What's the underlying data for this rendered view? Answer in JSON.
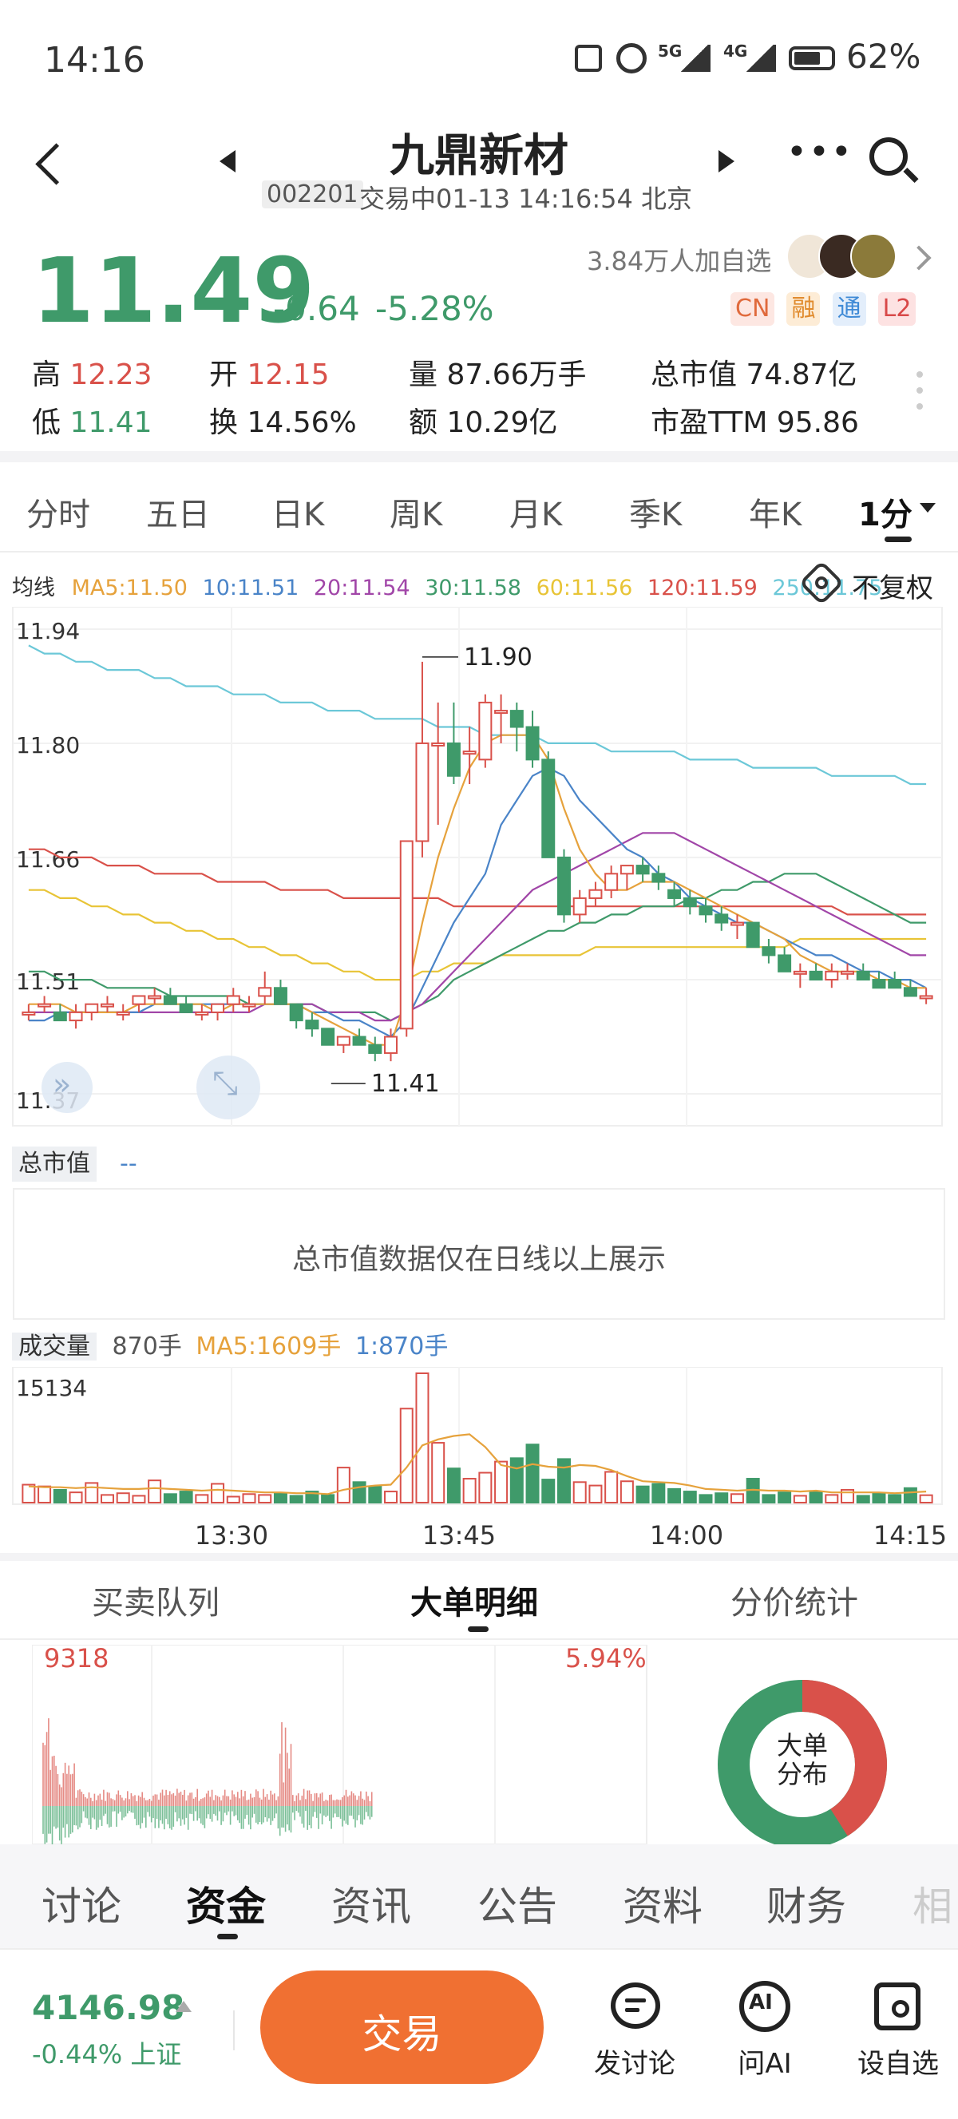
{
  "status_bar": {
    "time": "14:16",
    "battery": "62%",
    "net1": "5G",
    "net2": "4G"
  },
  "header": {
    "title": "九鼎新材",
    "code": "002201",
    "status": "交易中01-13 14:16:54 北京"
  },
  "quote": {
    "price": "11.49",
    "change": "-0.64",
    "change_pct": "-5.28%",
    "watchers": "3.84万人加自选",
    "badges": [
      "CN",
      "融",
      "通",
      "L2"
    ],
    "stats": [
      {
        "label": "高",
        "value": "12.23",
        "tone": "red"
      },
      {
        "label": "开",
        "value": "12.15",
        "tone": "red"
      },
      {
        "label": "量",
        "value": "87.66万手",
        "tone": "dark"
      },
      {
        "label": "总市值",
        "value": "74.87亿",
        "tone": "dark"
      },
      {
        "label": "低",
        "value": "11.41",
        "tone": "green"
      },
      {
        "label": "换",
        "value": "14.56%",
        "tone": "dark"
      },
      {
        "label": "额",
        "value": "10.29亿",
        "tone": "dark"
      },
      {
        "label": "市盈TTM",
        "value": "95.86",
        "tone": "dark"
      }
    ]
  },
  "period_tabs": [
    "分时",
    "五日",
    "日K",
    "周K",
    "月K",
    "季K",
    "年K",
    "1分"
  ],
  "ma_legend": {
    "label": "均线",
    "items": [
      {
        "text": "MA5:11.50",
        "color": "#e6a23c"
      },
      {
        "text": "10:11.51",
        "color": "#4a84c8"
      },
      {
        "text": "20:11.54",
        "color": "#a146a8"
      },
      {
        "text": "30:11.58",
        "color": "#3f9a6a"
      },
      {
        "text": "60:11.56",
        "color": "#e8c436"
      },
      {
        "text": "120:11.59",
        "color": "#d9514a"
      },
      {
        "text": "250:11.75",
        "color": "#6cc8d8"
      }
    ],
    "adjust": "不复权"
  },
  "chart_data": {
    "type": "candlestick",
    "y_ticks": [
      "11.94",
      "11.80",
      "11.66",
      "11.51",
      "11.37"
    ],
    "ylim": [
      11.37,
      11.94
    ],
    "high_annotation": "11.90",
    "low_annotation": "11.41",
    "candles": [
      [
        11.47,
        11.48,
        11.46,
        11.47
      ],
      [
        11.48,
        11.49,
        11.47,
        11.48
      ],
      [
        11.47,
        11.48,
        11.46,
        11.46
      ],
      [
        11.46,
        11.48,
        11.45,
        11.47
      ],
      [
        11.47,
        11.48,
        11.46,
        11.48
      ],
      [
        11.48,
        11.49,
        11.47,
        11.48
      ],
      [
        11.47,
        11.48,
        11.46,
        11.47
      ],
      [
        11.48,
        11.49,
        11.47,
        11.49
      ],
      [
        11.49,
        11.5,
        11.48,
        11.49
      ],
      [
        11.49,
        11.5,
        11.48,
        11.48
      ],
      [
        11.48,
        11.49,
        11.47,
        11.47
      ],
      [
        11.47,
        11.48,
        11.46,
        11.47
      ],
      [
        11.47,
        11.48,
        11.46,
        11.48
      ],
      [
        11.48,
        11.5,
        11.47,
        11.49
      ],
      [
        11.48,
        11.49,
        11.47,
        11.48
      ],
      [
        11.49,
        11.52,
        11.48,
        11.5
      ],
      [
        11.5,
        11.51,
        11.48,
        11.48
      ],
      [
        11.48,
        11.48,
        11.45,
        11.46
      ],
      [
        11.46,
        11.47,
        11.44,
        11.45
      ],
      [
        11.45,
        11.45,
        11.43,
        11.43
      ],
      [
        11.43,
        11.44,
        11.42,
        11.44
      ],
      [
        11.44,
        11.45,
        11.43,
        11.43
      ],
      [
        11.43,
        11.44,
        11.41,
        11.42
      ],
      [
        11.42,
        11.45,
        11.41,
        11.44
      ],
      [
        11.45,
        11.68,
        11.44,
        11.68
      ],
      [
        11.68,
        11.9,
        11.66,
        11.8
      ],
      [
        11.8,
        11.85,
        11.7,
        11.8
      ],
      [
        11.8,
        11.85,
        11.75,
        11.76
      ],
      [
        11.79,
        11.82,
        11.75,
        11.79
      ],
      [
        11.78,
        11.86,
        11.77,
        11.85
      ],
      [
        11.84,
        11.86,
        11.8,
        11.84
      ],
      [
        11.84,
        11.85,
        11.79,
        11.82
      ],
      [
        11.82,
        11.84,
        11.77,
        11.78
      ],
      [
        11.78,
        11.79,
        11.66,
        11.66
      ],
      [
        11.66,
        11.67,
        11.58,
        11.59
      ],
      [
        11.59,
        11.62,
        11.58,
        11.61
      ],
      [
        11.61,
        11.63,
        11.6,
        11.62
      ],
      [
        11.62,
        11.65,
        11.61,
        11.64
      ],
      [
        11.64,
        11.65,
        11.62,
        11.65
      ],
      [
        11.65,
        11.66,
        11.63,
        11.64
      ],
      [
        11.64,
        11.65,
        11.62,
        11.63
      ],
      [
        11.62,
        11.63,
        11.6,
        11.61
      ],
      [
        11.61,
        11.62,
        11.59,
        11.6
      ],
      [
        11.6,
        11.61,
        11.58,
        11.59
      ],
      [
        11.59,
        11.6,
        11.57,
        11.58
      ],
      [
        11.58,
        11.59,
        11.56,
        11.58
      ],
      [
        11.58,
        11.58,
        11.55,
        11.55
      ],
      [
        11.55,
        11.56,
        11.53,
        11.54
      ],
      [
        11.54,
        11.55,
        11.52,
        11.52
      ],
      [
        11.52,
        11.53,
        11.5,
        11.52
      ],
      [
        11.52,
        11.53,
        11.51,
        11.51
      ],
      [
        11.51,
        11.53,
        11.5,
        11.52
      ],
      [
        11.52,
        11.53,
        11.51,
        11.52
      ],
      [
        11.52,
        11.53,
        11.51,
        11.51
      ],
      [
        11.51,
        11.52,
        11.5,
        11.5
      ],
      [
        11.51,
        11.52,
        11.5,
        11.5
      ],
      [
        11.5,
        11.51,
        11.49,
        11.49
      ],
      [
        11.49,
        11.5,
        11.48,
        11.49
      ]
    ],
    "ma_lines": [
      {
        "name": "MA5",
        "color": "#e6a23c",
        "values": [
          11.48,
          11.48,
          11.48,
          11.47,
          11.47,
          11.47,
          11.47,
          11.48,
          11.48,
          11.48,
          11.48,
          11.48,
          11.47,
          11.48,
          11.48,
          11.48,
          11.48,
          11.48,
          11.47,
          11.46,
          11.45,
          11.44,
          11.43,
          11.43,
          11.49,
          11.58,
          11.66,
          11.72,
          11.77,
          11.8,
          11.81,
          11.81,
          11.81,
          11.78,
          11.72,
          11.67,
          11.64,
          11.62,
          11.62,
          11.63,
          11.63,
          11.63,
          11.62,
          11.61,
          11.6,
          11.59,
          11.58,
          11.57,
          11.56,
          11.54,
          11.53,
          11.52,
          11.52,
          11.52,
          11.51,
          11.51,
          11.5,
          11.5
        ]
      },
      {
        "name": "MA10",
        "color": "#4a84c8",
        "values": [
          11.46,
          11.46,
          11.47,
          11.47,
          11.47,
          11.47,
          11.47,
          11.47,
          11.48,
          11.48,
          11.48,
          11.48,
          11.48,
          11.48,
          11.48,
          11.48,
          11.48,
          11.48,
          11.47,
          11.47,
          11.46,
          11.46,
          11.45,
          11.44,
          11.46,
          11.5,
          11.54,
          11.58,
          11.61,
          11.64,
          11.7,
          11.73,
          11.76,
          11.77,
          11.76,
          11.73,
          11.71,
          11.69,
          11.67,
          11.66,
          11.64,
          11.63,
          11.61,
          11.6,
          11.59,
          11.58,
          11.58,
          11.57,
          11.56,
          11.55,
          11.54,
          11.54,
          11.53,
          11.52,
          11.52,
          11.51,
          11.51,
          11.5
        ]
      },
      {
        "name": "MA20",
        "color": "#a146a8",
        "values": [
          11.47,
          11.47,
          11.47,
          11.47,
          11.47,
          11.47,
          11.47,
          11.47,
          11.47,
          11.47,
          11.47,
          11.47,
          11.47,
          11.47,
          11.47,
          11.48,
          11.48,
          11.48,
          11.48,
          11.47,
          11.47,
          11.47,
          11.46,
          11.46,
          11.47,
          11.48,
          11.5,
          11.52,
          11.54,
          11.56,
          11.58,
          11.6,
          11.62,
          11.63,
          11.64,
          11.65,
          11.66,
          11.67,
          11.68,
          11.69,
          11.69,
          11.69,
          11.68,
          11.67,
          11.66,
          11.65,
          11.64,
          11.63,
          11.62,
          11.61,
          11.6,
          11.59,
          11.58,
          11.57,
          11.56,
          11.55,
          11.54,
          11.54
        ]
      },
      {
        "name": "MA30",
        "color": "#3f9a6a",
        "values": [
          11.52,
          11.52,
          11.51,
          11.51,
          11.51,
          11.5,
          11.5,
          11.5,
          11.5,
          11.49,
          11.49,
          11.49,
          11.49,
          11.49,
          11.48,
          11.48,
          11.48,
          11.48,
          11.48,
          11.47,
          11.47,
          11.47,
          11.47,
          11.46,
          11.47,
          11.48,
          11.49,
          11.51,
          11.52,
          11.53,
          11.54,
          11.55,
          11.56,
          11.57,
          11.57,
          11.58,
          11.58,
          11.59,
          11.59,
          11.6,
          11.6,
          11.6,
          11.61,
          11.61,
          11.62,
          11.62,
          11.63,
          11.63,
          11.64,
          11.64,
          11.64,
          11.63,
          11.62,
          11.61,
          11.6,
          11.59,
          11.58,
          11.58
        ]
      },
      {
        "name": "MA60",
        "color": "#e8c436",
        "values": [
          11.62,
          11.62,
          11.61,
          11.61,
          11.6,
          11.6,
          11.59,
          11.59,
          11.58,
          11.58,
          11.57,
          11.57,
          11.56,
          11.56,
          11.55,
          11.55,
          11.54,
          11.54,
          11.53,
          11.53,
          11.52,
          11.52,
          11.51,
          11.51,
          11.51,
          11.52,
          11.52,
          11.53,
          11.53,
          11.53,
          11.54,
          11.54,
          11.54,
          11.54,
          11.54,
          11.54,
          11.55,
          11.55,
          11.55,
          11.55,
          11.55,
          11.55,
          11.55,
          11.55,
          11.55,
          11.55,
          11.55,
          11.55,
          11.55,
          11.56,
          11.56,
          11.56,
          11.56,
          11.56,
          11.56,
          11.56,
          11.56,
          11.56
        ]
      },
      {
        "name": "MA120",
        "color": "#d9514a",
        "values": [
          11.67,
          11.67,
          11.66,
          11.66,
          11.66,
          11.65,
          11.65,
          11.65,
          11.64,
          11.64,
          11.64,
          11.64,
          11.63,
          11.63,
          11.63,
          11.63,
          11.62,
          11.62,
          11.62,
          11.62,
          11.61,
          11.61,
          11.61,
          11.61,
          11.61,
          11.61,
          11.61,
          11.6,
          11.6,
          11.6,
          11.6,
          11.6,
          11.6,
          11.6,
          11.6,
          11.6,
          11.6,
          11.6,
          11.6,
          11.6,
          11.6,
          11.6,
          11.6,
          11.6,
          11.6,
          11.6,
          11.6,
          11.6,
          11.6,
          11.6,
          11.6,
          11.6,
          11.59,
          11.59,
          11.59,
          11.59,
          11.59,
          11.59
        ]
      },
      {
        "name": "MA250",
        "color": "#6cc8d8",
        "values": [
          11.92,
          11.91,
          11.91,
          11.9,
          11.9,
          11.89,
          11.89,
          11.89,
          11.88,
          11.88,
          11.87,
          11.87,
          11.87,
          11.86,
          11.86,
          11.86,
          11.85,
          11.85,
          11.85,
          11.84,
          11.84,
          11.84,
          11.83,
          11.83,
          11.83,
          11.83,
          11.82,
          11.82,
          11.82,
          11.81,
          11.81,
          11.81,
          11.81,
          11.8,
          11.8,
          11.8,
          11.8,
          11.79,
          11.79,
          11.79,
          11.79,
          11.79,
          11.78,
          11.78,
          11.78,
          11.78,
          11.77,
          11.77,
          11.77,
          11.77,
          11.77,
          11.76,
          11.76,
          11.76,
          11.76,
          11.76,
          11.75,
          11.75
        ]
      }
    ],
    "volume": {
      "max_label": "15134",
      "values": [
        2100,
        1900,
        1500,
        1200,
        2300,
        900,
        1100,
        800,
        2600,
        1000,
        1300,
        900,
        2200,
        700,
        1000,
        900,
        1100,
        800,
        1300,
        900,
        4100,
        2400,
        1900,
        1300,
        11000,
        15134,
        7000,
        4000,
        2800,
        3500,
        4800,
        5200,
        6800,
        2700,
        5100,
        2400,
        2000,
        3600,
        2500,
        1900,
        2200,
        1600,
        1300,
        900,
        1100,
        1000,
        2800,
        900,
        1200,
        800,
        1300,
        900,
        1500,
        800,
        1100,
        900,
        1700,
        870
      ],
      "ma5": [
        1900,
        1800,
        1800,
        1700,
        1800,
        1700,
        1600,
        1600,
        1700,
        1600,
        1500,
        1400,
        1500,
        1400,
        1300,
        1200,
        1200,
        1100,
        1100,
        1000,
        1500,
        1800,
        2000,
        2100,
        4100,
        6700,
        7400,
        7800,
        8000,
        6500,
        4400,
        4000,
        4500,
        4200,
        4100,
        4400,
        4300,
        3800,
        3100,
        2500,
        2400,
        2300,
        2000,
        1600,
        1500,
        1400,
        1500,
        1400,
        1400,
        1300,
        1400,
        1200,
        1200,
        1200,
        1200,
        1100,
        1200,
        1300
      ]
    },
    "volume_legend": {
      "label": "成交量",
      "value": "870手",
      "ma5": "MA5:1609手",
      "ma1": "1:870手"
    },
    "time_ticks": [
      "13:30",
      "13:45",
      "14:00",
      "14:15"
    ]
  },
  "market_cap": {
    "label": "总市值",
    "value": "--",
    "note": "总市值数据仅在日线以上展示"
  },
  "sub_tabs": [
    "买卖队列",
    "大单明细",
    "分价统计"
  ],
  "big_order": {
    "left_label": "9318",
    "right_label": "5.94%",
    "donut_label": "大单分布",
    "buy_share": 0.41,
    "sell_share": 0.59
  },
  "bottom_tabs": [
    "讨论",
    "资金",
    "资讯",
    "公告",
    "资料",
    "财务",
    "相"
  ],
  "index": {
    "value": "4146.98",
    "change": "-0.44% 上证"
  },
  "actions": {
    "trade": "交易",
    "discuss": "发讨论",
    "ai": "问AI",
    "ai_badge": "AI",
    "watchlist": "设自选"
  }
}
